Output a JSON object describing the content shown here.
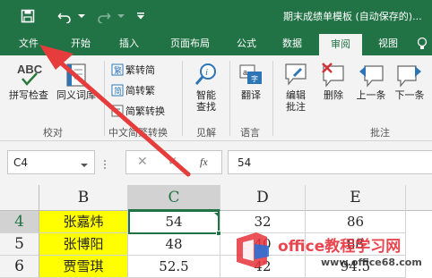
{
  "title_bar": {
    "title": "期末成绩单模板 (自动保存的)...",
    "quick_access": [
      "save-icon",
      "undo-icon",
      "undo-dropdown-icon",
      "redo-icon",
      "redo-dropdown-icon",
      "customize-quick-access-icon"
    ]
  },
  "tabs": [
    "文件",
    "开始",
    "插入",
    "页面布局",
    "公式",
    "数据",
    "审阅",
    "视图"
  ],
  "active_tab": "审阅",
  "ribbon": {
    "proofing": {
      "spell_check": "拼写检查",
      "thesaurus": "同义词库",
      "group_label": "校对"
    },
    "chinese_conversion": {
      "to_traditional": "繁转简",
      "to_simplified": "简转繁",
      "convert": "简繁转换",
      "group_label": "中文简繁转换"
    },
    "insights": {
      "smart_lookup_line1": "智能",
      "smart_lookup_line2": "查找",
      "group_label": "见解"
    },
    "language": {
      "translate": "翻译",
      "group_label": "语言"
    },
    "comments": {
      "edit_line1": "编辑",
      "edit_line2": "批注",
      "delete": "删除",
      "previous": "上一条",
      "next": "下一条",
      "group_label": "批注"
    }
  },
  "formula_bar": {
    "name_box": "C4",
    "cancel_symbol": "✕",
    "enter_symbol": "✓",
    "fx_symbol": "fx",
    "value": "54"
  },
  "columns": [
    "B",
    "C",
    "D",
    "E"
  ],
  "selected_column": "C",
  "rows": [
    {
      "num": "4",
      "B": "张嘉炜",
      "C": "54",
      "D": "32",
      "E": "86"
    },
    {
      "num": "5",
      "B": "张博阳",
      "C": "48",
      "D": "40",
      "E": "88"
    },
    {
      "num": "6",
      "B": "贾雪琪",
      "C": "52.5",
      "D": "42",
      "E": "94.5"
    }
  ],
  "selected_row": "4",
  "watermark": {
    "text": "office教程学习网",
    "url": "www.office68.com"
  },
  "colors": {
    "excel_green": "#217346",
    "highlight_yellow": "#ffff00",
    "arrow_red": "#e63c3c",
    "watermark_red": "#e8333c"
  }
}
